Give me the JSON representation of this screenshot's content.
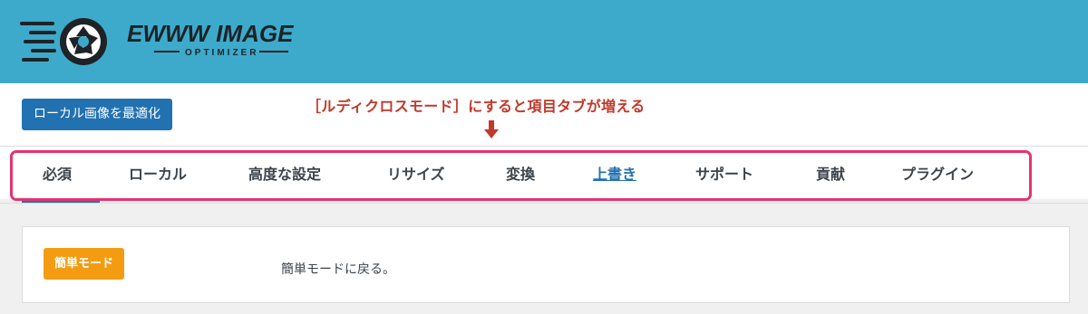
{
  "header": {
    "logo_text_main": "EWWW IMAGE",
    "logo_text_sub": "OPTIMIZER",
    "background_color": "#3eaacb"
  },
  "toolbar": {
    "optimize_button_label": "ローカル画像を最適化"
  },
  "annotation": {
    "text": "［ルディクロスモード］にすると項目タブが増える",
    "color": "#c0392b",
    "icon": "arrow-down-icon"
  },
  "tabs": [
    {
      "label": "必須"
    },
    {
      "label": "ローカル"
    },
    {
      "label": "高度な設定"
    },
    {
      "label": "リサイズ"
    },
    {
      "label": "変換"
    },
    {
      "label": "上書き",
      "active": true
    },
    {
      "label": "サポート"
    },
    {
      "label": "貢献"
    },
    {
      "label": "プラグイン"
    }
  ],
  "highlight_color": "#e5336f",
  "panel": {
    "easy_mode_button_label": "簡単モード",
    "back_text": "簡単モードに戻る。"
  }
}
